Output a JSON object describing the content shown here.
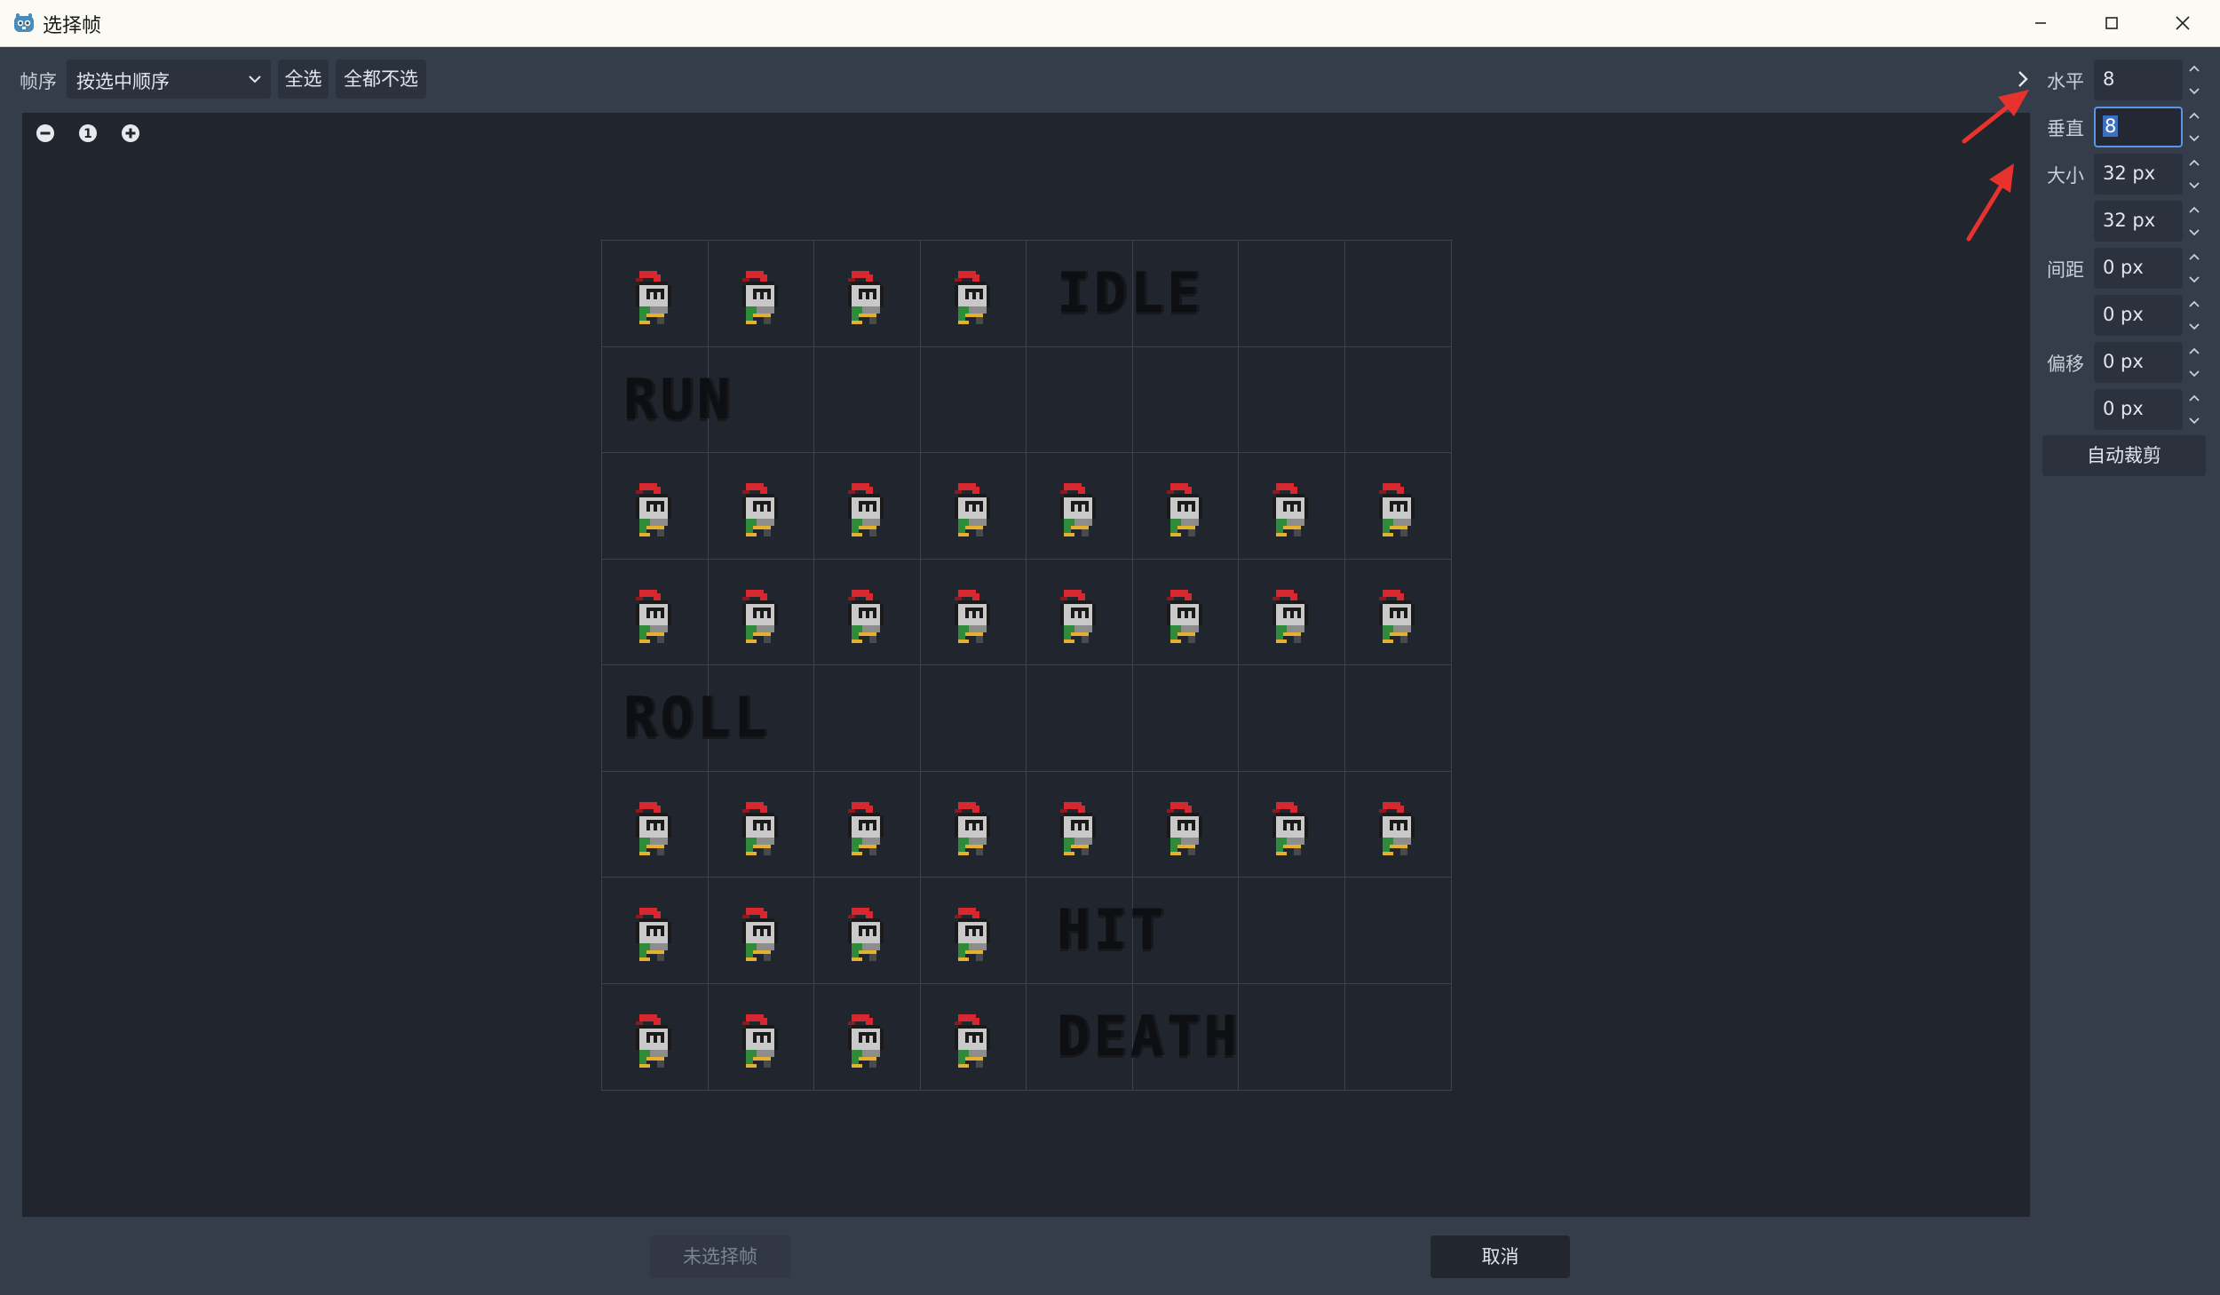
{
  "window": {
    "title": "选择帧",
    "icon": "godot-icon",
    "controls": [
      "minimize-icon",
      "maximize-icon",
      "close-icon"
    ]
  },
  "toolbar": {
    "order_label": "帧序",
    "order_select_value": "按选中顺序",
    "select_all": "全选",
    "select_none": "全都不选"
  },
  "zoom": {
    "icons": [
      "zoom-out-icon",
      "zoom-reset-icon",
      "zoom-in-icon"
    ],
    "reset_text": "1"
  },
  "sprite_sheet": {
    "columns": 8,
    "rows": 8,
    "labels": {
      "idle": "IDLE",
      "run": "RUN",
      "roll": "ROLL",
      "hit": "HIT",
      "death": "DEATH"
    },
    "knight_cells": [
      [
        0,
        0
      ],
      [
        0,
        1
      ],
      [
        0,
        2
      ],
      [
        0,
        3
      ],
      [
        2,
        0
      ],
      [
        2,
        1
      ],
      [
        2,
        2
      ],
      [
        2,
        3
      ],
      [
        2,
        4
      ],
      [
        2,
        5
      ],
      [
        2,
        6
      ],
      [
        2,
        7
      ],
      [
        3,
        0
      ],
      [
        3,
        1
      ],
      [
        3,
        2
      ],
      [
        3,
        3
      ],
      [
        3,
        4
      ],
      [
        3,
        5
      ],
      [
        3,
        6
      ],
      [
        3,
        7
      ],
      [
        5,
        0
      ],
      [
        5,
        1
      ],
      [
        5,
        2
      ],
      [
        5,
        3
      ],
      [
        5,
        4
      ],
      [
        5,
        5
      ],
      [
        5,
        6
      ],
      [
        5,
        7
      ],
      [
        6,
        0
      ],
      [
        6,
        1
      ],
      [
        6,
        2
      ],
      [
        6,
        3
      ],
      [
        7,
        0
      ],
      [
        7,
        1
      ],
      [
        7,
        2
      ],
      [
        7,
        3
      ]
    ]
  },
  "settings": {
    "horizontal_label": "水平",
    "horizontal_value": "8",
    "vertical_label": "垂直",
    "vertical_value": "8",
    "size_label": "大小",
    "size_x": "32 px",
    "size_y": "32 px",
    "separation_label": "间距",
    "separation_x": "0 px",
    "separation_y": "0 px",
    "offset_label": "偏移",
    "offset_x": "0 px",
    "offset_y": "0 px",
    "auto_slice": "自动裁剪"
  },
  "footer": {
    "no_frame_selected": "未选择帧",
    "cancel": "取消"
  },
  "colors": {
    "annotation_arrow": "#e8322e",
    "focus_border": "#5a96e6",
    "canvas_bg": "#21252e"
  }
}
